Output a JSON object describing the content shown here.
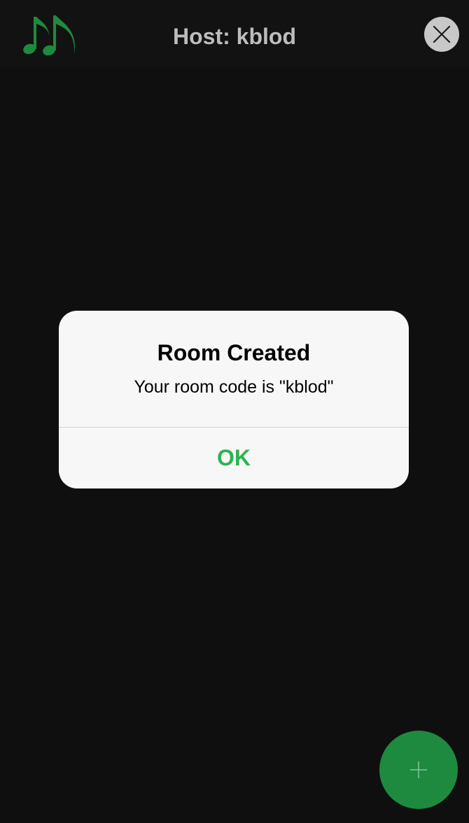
{
  "header": {
    "title": "Host: kblod",
    "logo_icon": "music-notes-icon",
    "close_icon": "close-icon"
  },
  "dialog": {
    "title": "Room Created",
    "message": "Your room code is \"kblod\"",
    "ok_label": "OK"
  },
  "fab": {
    "icon": "plus-icon"
  },
  "colors": {
    "background": "#0f0f0f",
    "accent_green": "#1e8a3f",
    "ok_green": "#2fb24f",
    "header_text": "#bdbdbd",
    "dialog_bg": "#f7f7f7"
  }
}
